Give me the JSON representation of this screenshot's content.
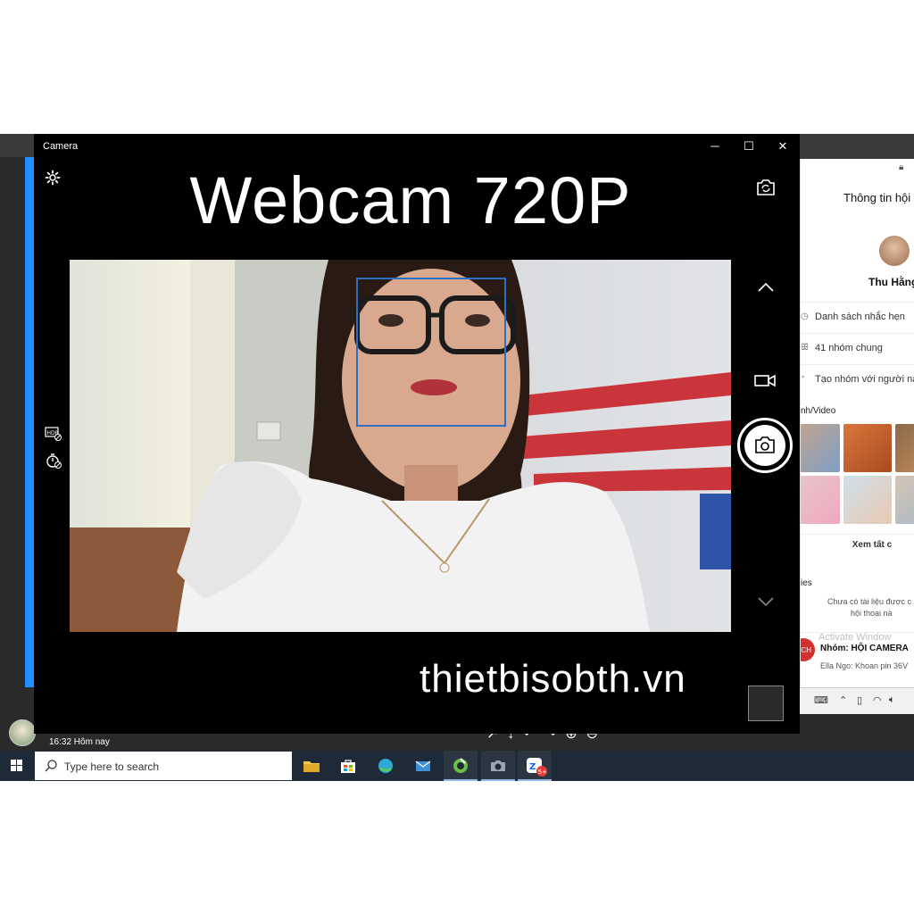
{
  "camera": {
    "window_title": "Camera",
    "overlay_title": "Webcam 720P",
    "watermark": "thietbisobth.vn",
    "controls": {
      "minimize": "─",
      "maximize": "☐",
      "close": "✕"
    }
  },
  "right_panel": {
    "title": "Thông tin hội",
    "name": "Thu Hằng",
    "rows": [
      {
        "icon": "clock-icon",
        "label": "Danh sách nhắc hẹn"
      },
      {
        "icon": "group-icon",
        "label": "41 nhóm chung"
      },
      {
        "icon": "add-group-icon",
        "label": "Tạo nhóm với người nà"
      }
    ],
    "media_title": "nh/Video",
    "see_all": "Xem tất c",
    "files_title": "ies",
    "files_empty_line1": "Chưa có tài liệu được c",
    "files_empty_line2": "hội thoại nà",
    "group": {
      "avatar_text": "CH",
      "name": "Nhóm: HỘI CAMERA",
      "message": "Ella Ngo: Khoan pin 36V"
    },
    "activate_text": "Activate Window"
  },
  "chat": {
    "time": "16:32 Hôm nay"
  },
  "taskbar": {
    "search_placeholder": "Type here to search",
    "apps": [
      {
        "name": "file-explorer",
        "color": "#f2c94c"
      },
      {
        "name": "microsoft-store",
        "color": "#ffffff"
      },
      {
        "name": "edge",
        "color": "#2fa8d8"
      },
      {
        "name": "mail",
        "color": "#3d8fd8"
      },
      {
        "name": "coccoc",
        "color": "#6abf45"
      },
      {
        "name": "camera",
        "color": "#9aa5b1"
      },
      {
        "name": "zalo",
        "color": "#0068ff"
      }
    ],
    "zalo_badge": "5+"
  }
}
